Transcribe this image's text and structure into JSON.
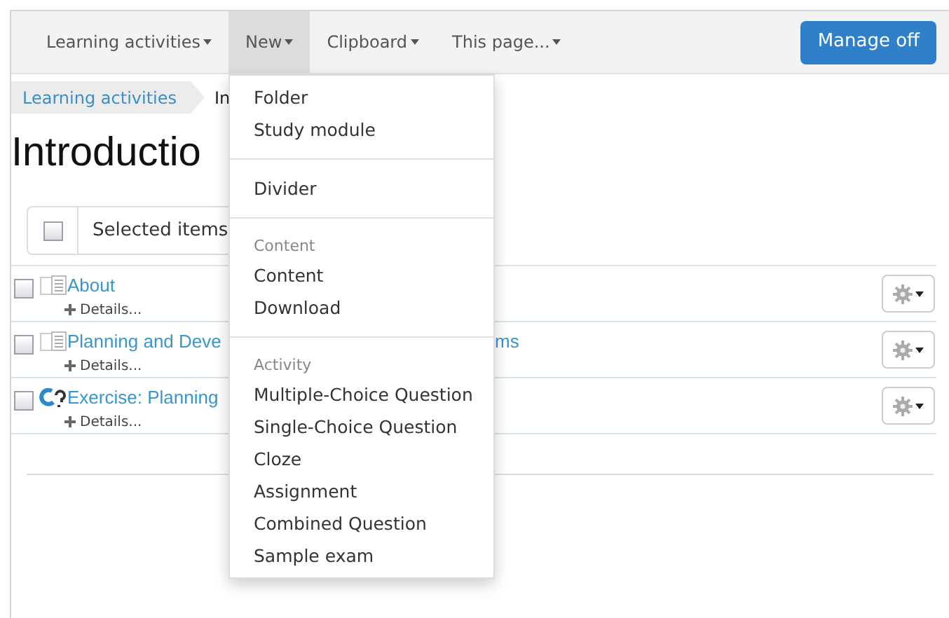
{
  "navbar": {
    "items": [
      {
        "label": "Learning activities",
        "selected": false
      },
      {
        "label": "New",
        "selected": true
      },
      {
        "label": "Clipboard",
        "selected": false
      },
      {
        "label": "This page...",
        "selected": false
      }
    ],
    "button": "Manage off"
  },
  "breadcrumb": [
    {
      "label": "Learning activities",
      "kind": "link"
    },
    {
      "label": "In",
      "kind": "current"
    }
  ],
  "heading": "Introductio",
  "toolbar": {
    "select_all_checked": false,
    "button": "Selected items"
  },
  "rows": [
    {
      "kind": "page",
      "title": "About",
      "title_tail": "",
      "details": "Details...",
      "checked": false
    },
    {
      "kind": "page",
      "title": "Planning and Deve",
      "title_tail": "ms",
      "details": "Details...",
      "checked": false
    },
    {
      "kind": "question",
      "title": "Exercise: Planning",
      "title_tail": "",
      "details": "Details...",
      "checked": false
    }
  ],
  "menu": [
    {
      "kind": "item",
      "label": "Folder"
    },
    {
      "kind": "item",
      "label": "Study module"
    },
    {
      "kind": "separator"
    },
    {
      "kind": "item",
      "label": "Divider"
    },
    {
      "kind": "separator"
    },
    {
      "kind": "header",
      "label": "Content"
    },
    {
      "kind": "item",
      "label": "Content"
    },
    {
      "kind": "item",
      "label": "Download"
    },
    {
      "kind": "separator"
    },
    {
      "kind": "header",
      "label": "Activity"
    },
    {
      "kind": "item",
      "label": "Multiple-Choice Question"
    },
    {
      "kind": "item",
      "label": "Single-Choice Question"
    },
    {
      "kind": "item",
      "label": "Cloze"
    },
    {
      "kind": "item",
      "label": "Assignment"
    },
    {
      "kind": "item",
      "label": "Combined Question"
    },
    {
      "kind": "item",
      "label": "Sample exam"
    }
  ]
}
